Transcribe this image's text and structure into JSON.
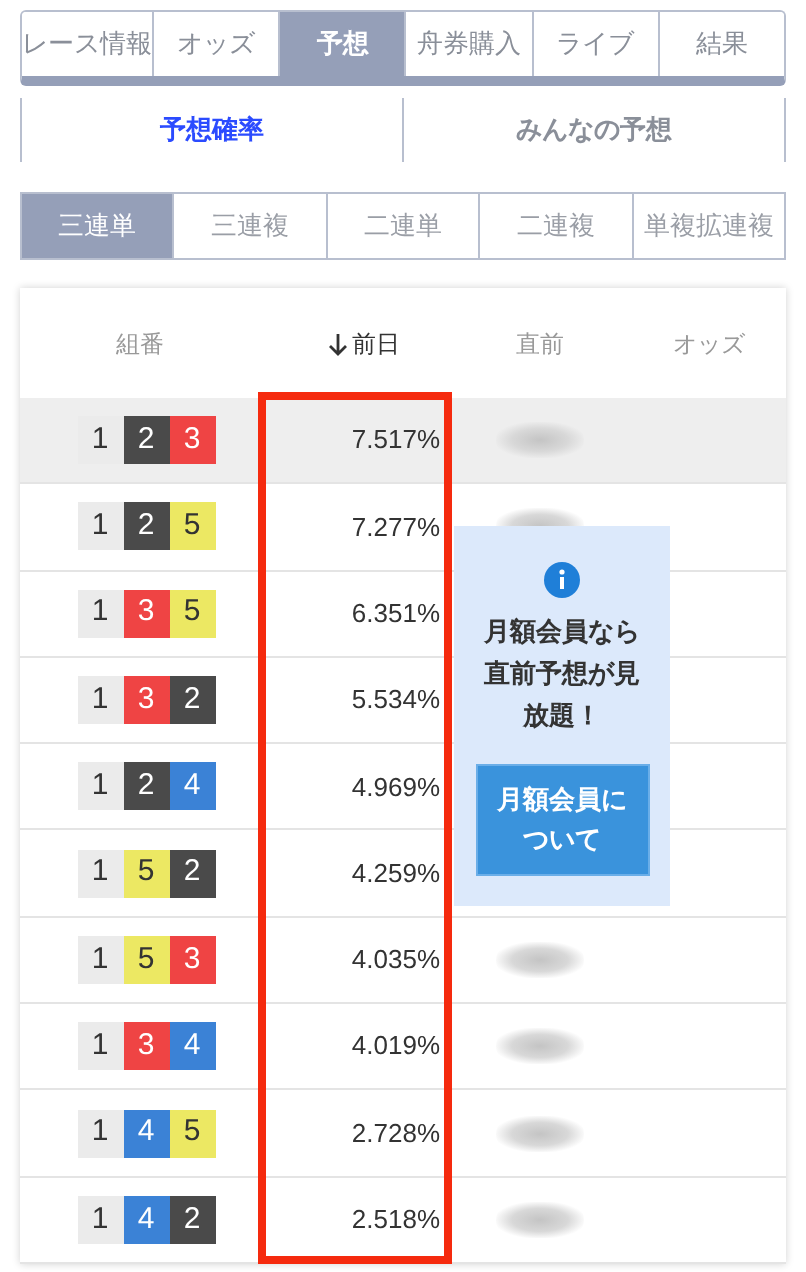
{
  "main_tabs": [
    {
      "label": "レース情報",
      "selected": false
    },
    {
      "label": "オッズ",
      "selected": false
    },
    {
      "label": "予想",
      "selected": true
    },
    {
      "label": "舟券購入",
      "selected": false
    },
    {
      "label": "ライブ",
      "selected": false
    },
    {
      "label": "結果",
      "selected": false
    }
  ],
  "sub_tabs": [
    {
      "label": "予想確率",
      "selected": true
    },
    {
      "label": "みんなの予想",
      "selected": false
    }
  ],
  "bet_tabs": [
    {
      "label": "三連単",
      "selected": true
    },
    {
      "label": "三連複",
      "selected": false
    },
    {
      "label": "二連単",
      "selected": false
    },
    {
      "label": "二連複",
      "selected": false
    },
    {
      "label": "単複拡連複",
      "selected": false
    }
  ],
  "table": {
    "columns": [
      {
        "label": "組番",
        "sorted": false
      },
      {
        "label": "前日",
        "sorted": true
      },
      {
        "label": "直前",
        "sorted": false
      },
      {
        "label": "オッズ",
        "sorted": false
      }
    ],
    "rows": [
      {
        "boats": [
          {
            "number": "1",
            "color": "#ebebeb"
          },
          {
            "number": "2",
            "color": "#4a4a4a"
          },
          {
            "number": "3",
            "color": "#ef4444"
          }
        ],
        "previous_day": "7.517%",
        "selected": true
      },
      {
        "boats": [
          {
            "number": "1",
            "color": "#ebebeb"
          },
          {
            "number": "2",
            "color": "#4a4a4a"
          },
          {
            "number": "5",
            "color": "#ece863"
          }
        ],
        "previous_day": "7.277%",
        "selected": false
      },
      {
        "boats": [
          {
            "number": "1",
            "color": "#ebebeb"
          },
          {
            "number": "3",
            "color": "#ef4444"
          },
          {
            "number": "5",
            "color": "#ece863"
          }
        ],
        "previous_day": "6.351%",
        "selected": false
      },
      {
        "boats": [
          {
            "number": "1",
            "color": "#ebebeb"
          },
          {
            "number": "3",
            "color": "#ef4444"
          },
          {
            "number": "2",
            "color": "#4a4a4a"
          }
        ],
        "previous_day": "5.534%",
        "selected": false
      },
      {
        "boats": [
          {
            "number": "1",
            "color": "#ebebeb"
          },
          {
            "number": "2",
            "color": "#4a4a4a"
          },
          {
            "number": "4",
            "color": "#3b82d6"
          }
        ],
        "previous_day": "4.969%",
        "selected": false
      },
      {
        "boats": [
          {
            "number": "1",
            "color": "#ebebeb"
          },
          {
            "number": "5",
            "color": "#ece863"
          },
          {
            "number": "2",
            "color": "#4a4a4a"
          }
        ],
        "previous_day": "4.259%",
        "selected": false
      },
      {
        "boats": [
          {
            "number": "1",
            "color": "#ebebeb"
          },
          {
            "number": "5",
            "color": "#ece863"
          },
          {
            "number": "3",
            "color": "#ef4444"
          }
        ],
        "previous_day": "4.035%",
        "selected": false
      },
      {
        "boats": [
          {
            "number": "1",
            "color": "#ebebeb"
          },
          {
            "number": "3",
            "color": "#ef4444"
          },
          {
            "number": "4",
            "color": "#3b82d6"
          }
        ],
        "previous_day": "4.019%",
        "selected": false
      },
      {
        "boats": [
          {
            "number": "1",
            "color": "#ebebeb"
          },
          {
            "number": "4",
            "color": "#3b82d6"
          },
          {
            "number": "5",
            "color": "#ece863"
          }
        ],
        "previous_day": "2.728%",
        "selected": false
      },
      {
        "boats": [
          {
            "number": "1",
            "color": "#ebebeb"
          },
          {
            "number": "4",
            "color": "#3b82d6"
          },
          {
            "number": "2",
            "color": "#4a4a4a"
          }
        ],
        "previous_day": "2.518%",
        "selected": false
      }
    ]
  },
  "member_popup": {
    "message": "月額会員なら直前予想が見放題！",
    "button": "月額会員について"
  }
}
